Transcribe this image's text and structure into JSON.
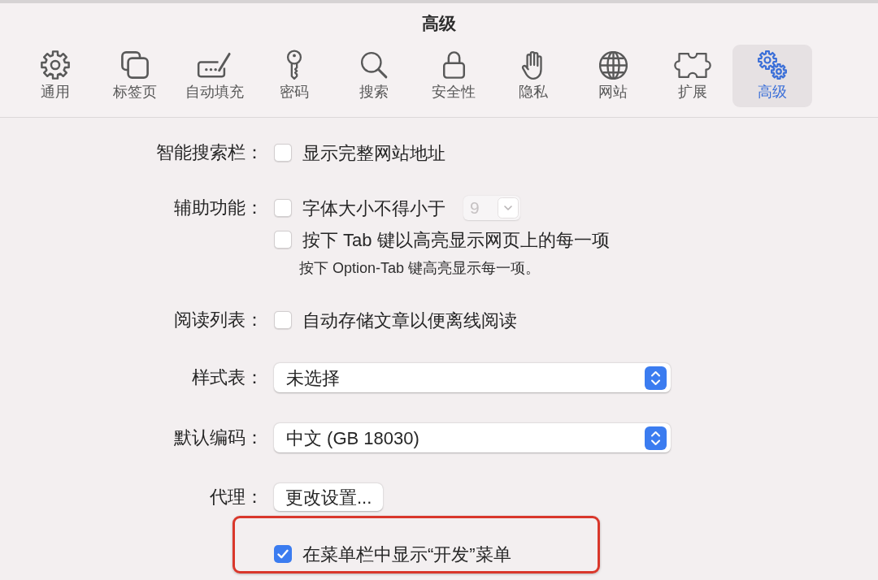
{
  "window": {
    "title": "高级"
  },
  "tabs": [
    {
      "label": "通用",
      "selected": false
    },
    {
      "label": "标签页",
      "selected": false
    },
    {
      "label": "自动填充",
      "selected": false
    },
    {
      "label": "密码",
      "selected": false
    },
    {
      "label": "搜索",
      "selected": false
    },
    {
      "label": "安全性",
      "selected": false
    },
    {
      "label": "隐私",
      "selected": false
    },
    {
      "label": "网站",
      "selected": false
    },
    {
      "label": "扩展",
      "selected": false
    },
    {
      "label": "高级",
      "selected": true
    }
  ],
  "settings": [
    {
      "label": "智能搜索栏：",
      "highlighted": false,
      "controls": [
        {
          "kind": "checkbox",
          "text": "显示完整网站地址",
          "checked": false
        }
      ]
    },
    {
      "label": "辅助功能：",
      "highlighted": false,
      "controls": [
        {
          "kind": "checkbox",
          "text": "字体大小不得小于",
          "checked": false,
          "font_size": {
            "value": "9",
            "disabled": true
          }
        },
        {
          "kind": "checkbox",
          "text": "按下 Tab 键以高亮显示网页上的每一项",
          "checked": false
        },
        {
          "kind": "note",
          "text": "按下 Option-Tab 键高亮显示每一项。"
        }
      ]
    },
    {
      "label": "阅读列表：",
      "highlighted": false,
      "controls": [
        {
          "kind": "checkbox",
          "text": "自动存储文章以便离线阅读",
          "checked": false
        }
      ]
    },
    {
      "label": "样式表：",
      "highlighted": false,
      "controls": [
        {
          "kind": "popup",
          "value": "未选择"
        }
      ]
    },
    {
      "label": "默认编码：",
      "highlighted": false,
      "controls": [
        {
          "kind": "popup",
          "value": "中文 (GB 18030)"
        }
      ]
    },
    {
      "label": "代理：",
      "highlighted": false,
      "controls": [
        {
          "kind": "button",
          "text": "更改设置..."
        }
      ]
    },
    {
      "highlighted": true,
      "controls": [
        {
          "kind": "checkbox",
          "text": "在菜单栏中显示“开发”菜单",
          "checked": true
        }
      ]
    }
  ]
}
